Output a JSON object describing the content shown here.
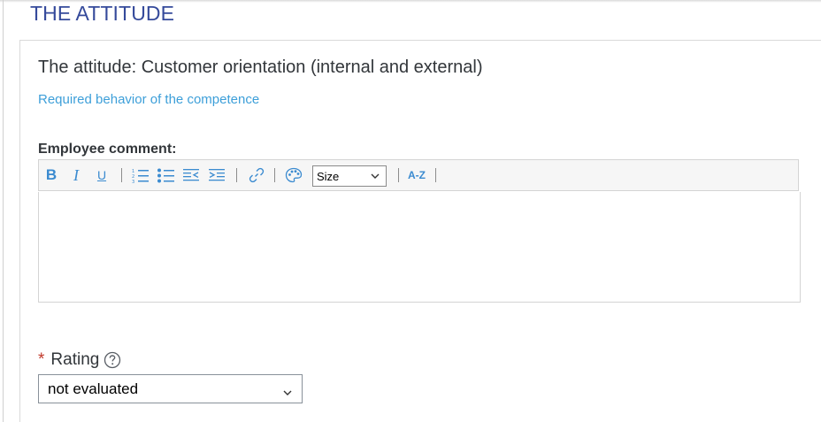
{
  "section": {
    "title": "THE ATTITUDE"
  },
  "competence": {
    "title": "The attitude: Customer orientation (internal and external)",
    "required_link": "Required behavior of the competence"
  },
  "comment": {
    "label": "Employee comment:",
    "toolbar": {
      "bold": "B",
      "italic": "I",
      "underline": "U",
      "size_select_value": "Size",
      "case_label": "A-Z",
      "icons": [
        "bold-icon",
        "italic-icon",
        "underline-icon",
        "numbered-list-icon",
        "bulleted-list-icon",
        "outdent-icon",
        "indent-icon",
        "link-icon",
        "color-palette-icon",
        "chevron-down-icon",
        "text-case-icon"
      ]
    },
    "value": ""
  },
  "rating": {
    "required_marker": "*",
    "label": "Rating",
    "selected_value": "not evaluated",
    "help_icon": "question-circle-icon",
    "chevron_icon": "chevron-down-icon"
  },
  "colors": {
    "section_title": "#354a9b",
    "link": "#3d9fd9",
    "toolbar_icon": "#3b8bd0",
    "required_star": "#c1392b",
    "text": "#32363a"
  }
}
